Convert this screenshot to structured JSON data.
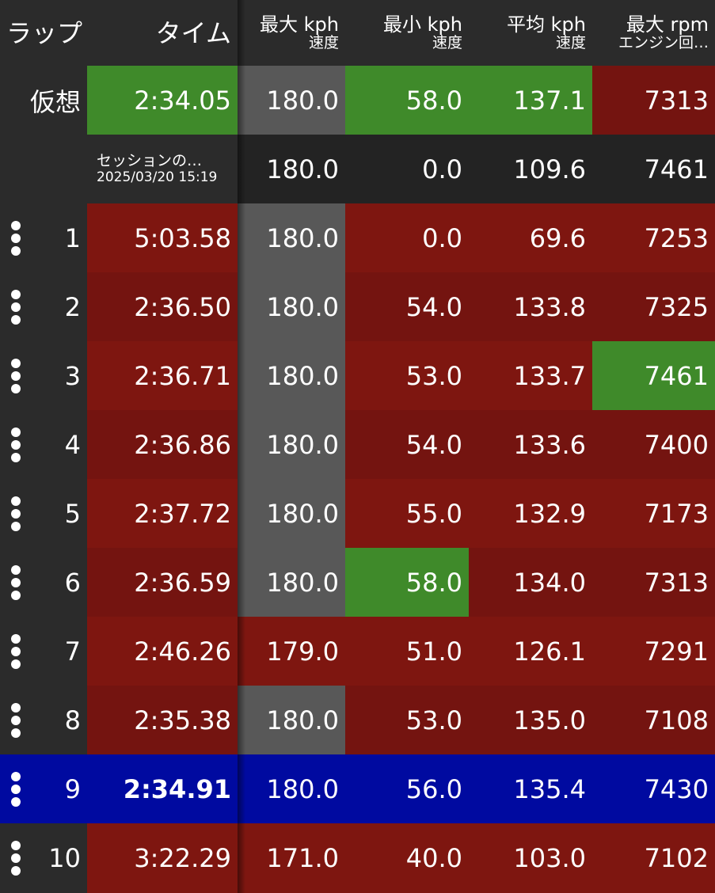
{
  "header": {
    "lap": "ラップ",
    "time": "タイム",
    "max_speed": {
      "main": "最大 kph",
      "sub": "速度"
    },
    "min_speed": {
      "main": "最小 kph",
      "sub": "速度"
    },
    "avg_speed": {
      "main": "平均 kph",
      "sub": "速度"
    },
    "max_rpm": {
      "main": "最大 rpm",
      "sub": "エンジン回…"
    }
  },
  "virtual": {
    "label": "仮想",
    "time": "2:34.05",
    "max": "180.0",
    "min": "58.0",
    "avg": "137.1",
    "rpm": "7313"
  },
  "session": {
    "label": "セッションの…",
    "datetime": "2025/03/20 15:19",
    "max": "180.0",
    "min": "0.0",
    "avg": "109.6",
    "rpm": "7461"
  },
  "laps": [
    {
      "lap": "1",
      "time": "5:03.58",
      "max": "180.0",
      "min": "0.0",
      "avg": "69.6",
      "rpm": "7253"
    },
    {
      "lap": "2",
      "time": "2:36.50",
      "max": "180.0",
      "min": "54.0",
      "avg": "133.8",
      "rpm": "7325"
    },
    {
      "lap": "3",
      "time": "2:36.71",
      "max": "180.0",
      "min": "53.0",
      "avg": "133.7",
      "rpm": "7461"
    },
    {
      "lap": "4",
      "time": "2:36.86",
      "max": "180.0",
      "min": "54.0",
      "avg": "133.6",
      "rpm": "7400"
    },
    {
      "lap": "5",
      "time": "2:37.72",
      "max": "180.0",
      "min": "55.0",
      "avg": "132.9",
      "rpm": "7173"
    },
    {
      "lap": "6",
      "time": "2:36.59",
      "max": "180.0",
      "min": "58.0",
      "avg": "134.0",
      "rpm": "7313"
    },
    {
      "lap": "7",
      "time": "2:46.26",
      "max": "179.0",
      "min": "51.0",
      "avg": "126.1",
      "rpm": "7291"
    },
    {
      "lap": "8",
      "time": "2:35.38",
      "max": "180.0",
      "min": "53.0",
      "avg": "135.0",
      "rpm": "7108"
    },
    {
      "lap": "9",
      "time": "2:34.91",
      "max": "180.0",
      "min": "56.0",
      "avg": "135.4",
      "rpm": "7430"
    },
    {
      "lap": "10",
      "time": "3:22.29",
      "max": "171.0",
      "min": "40.0",
      "avg": "103.0",
      "rpm": "7102"
    }
  ],
  "selected_lap": "9",
  "colors": {
    "best": "#3f8a2a",
    "worse": "#7e1610",
    "equal_max": "#585858",
    "selected": "#000aa0",
    "row_bg": "#2b2b2b"
  }
}
